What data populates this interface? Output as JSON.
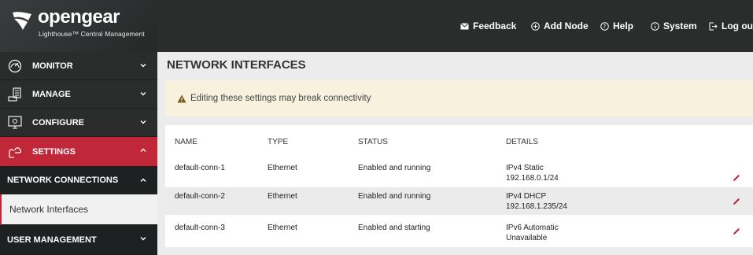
{
  "brand": {
    "name": "opengear",
    "subtitle": "Lighthouse™ Central Management"
  },
  "topnav": {
    "feedback": "Feedback",
    "add_node": "Add Node",
    "help": "Help",
    "system": "System",
    "logout": "Log out"
  },
  "sidebar": {
    "monitor": "MONITOR",
    "manage": "MANAGE",
    "configure": "CONFIGURE",
    "settings": "SETTINGS",
    "network_connections": "NETWORK CONNECTIONS",
    "network_interfaces": "Network Interfaces",
    "user_management": "USER MANAGEMENT"
  },
  "main": {
    "title": "NETWORK INTERFACES",
    "warning": "Editing these settings may break connectivity",
    "columns": [
      "NAME",
      "TYPE",
      "STATUS",
      "DETAILS"
    ],
    "rows": [
      {
        "name": "default-conn-1",
        "type": "Ethernet",
        "status": "Enabled and running",
        "details_1": "IPv4 Static",
        "details_2": "192.168.0.1/24"
      },
      {
        "name": "default-conn-2",
        "type": "Ethernet",
        "status": "Enabled and running",
        "details_1": "IPv4 DHCP",
        "details_2": "192.168.1.235/24"
      },
      {
        "name": "default-conn-3",
        "type": "Ethernet",
        "status": "Enabled and starting",
        "details_1": "IPv6 Automatic",
        "details_2": "Unavailable"
      }
    ]
  },
  "colors": {
    "accent_red": "#c0283a",
    "dark_bg": "#2b2d2d",
    "warning_bg": "#f7f1dd",
    "warning_icon": "#7a5a1a"
  },
  "icons": {
    "feedback": "envelope-icon",
    "add_node": "plus-circle-icon",
    "help": "question-circle-icon",
    "system": "info-circle-icon",
    "logout": "logout-icon",
    "edit": "pencil-icon"
  }
}
